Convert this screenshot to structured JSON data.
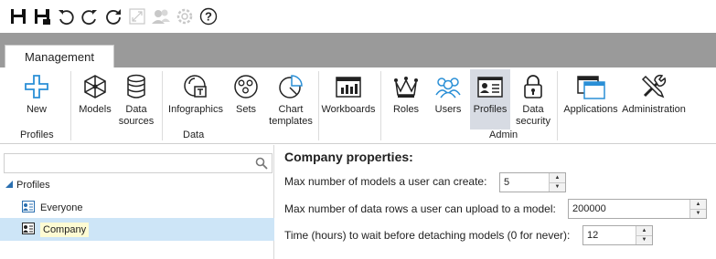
{
  "quick_access": {
    "items": [
      "save-icon",
      "save-as-icon",
      "undo-icon",
      "redo-icon",
      "refresh-icon",
      "fullscreen-icon",
      "users-icon",
      "settings-icon",
      "help-icon"
    ],
    "help_glyph": "?"
  },
  "ribbon": {
    "tab": "Management",
    "buttons": {
      "new": "New",
      "models": "Models",
      "data_sources": "Data\nsources",
      "infographics": "Infographics",
      "sets": "Sets",
      "chart_templates": "Chart\ntemplates",
      "workboards": "Workboards",
      "roles": "Roles",
      "users": "Users",
      "profiles": "Profiles",
      "data_security": "Data\nsecurity",
      "applications": "Applications",
      "administration": "Administration"
    },
    "groups": {
      "profiles": "Profiles",
      "data": "Data",
      "admin": "Admin"
    },
    "accent": "#2a8fd6"
  },
  "left_panel": {
    "search": {
      "value": "",
      "placeholder": ""
    },
    "tree_root": "Profiles",
    "items": [
      "Everyone",
      "Company"
    ],
    "selected_item": "Company"
  },
  "properties": {
    "title": "Company properties:",
    "fields": [
      {
        "label": "Max number of models a user can create:",
        "value": "5"
      },
      {
        "label": "Max number of data rows a user can upload to a model:",
        "value": "200000"
      },
      {
        "label": "Time (hours) to wait before detaching models (0 for never):",
        "value": "12"
      }
    ]
  }
}
